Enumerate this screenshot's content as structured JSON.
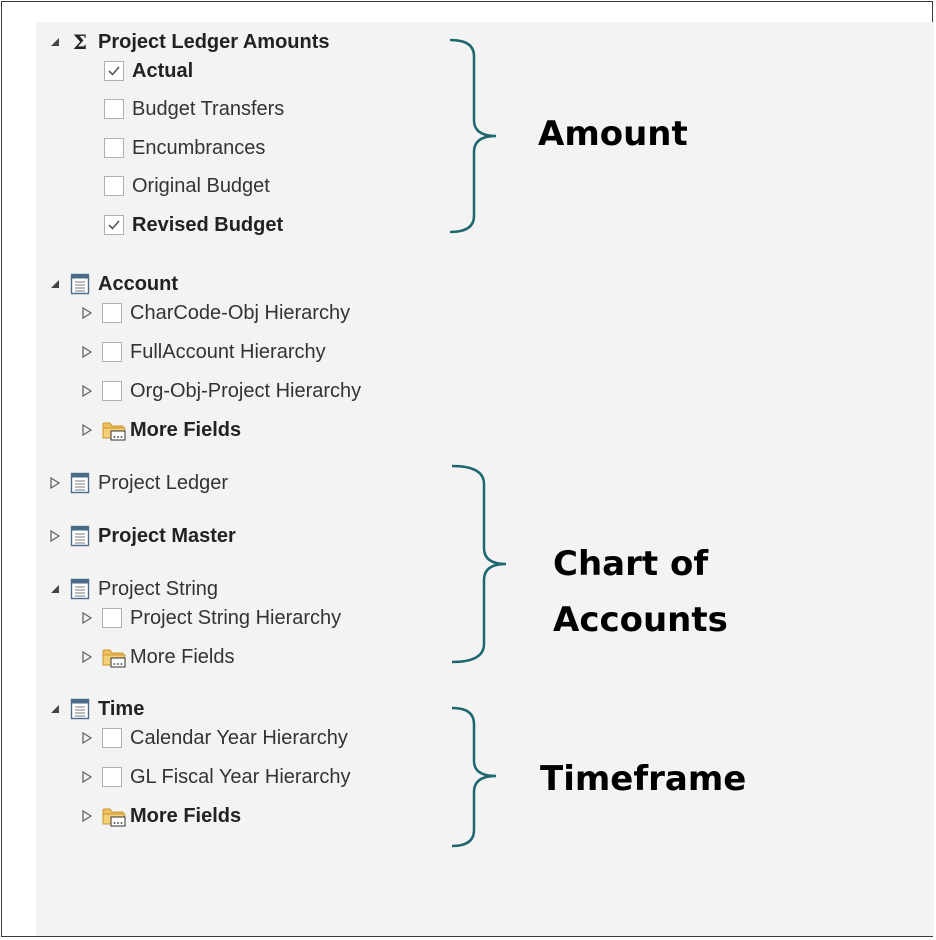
{
  "tree": {
    "ledger_amounts": {
      "label": "Project Ledger Amounts",
      "icon": "sigma-icon",
      "glyph": "Σ",
      "items": [
        {
          "label": "Actual",
          "checked": true
        },
        {
          "label": "Budget Transfers",
          "checked": false
        },
        {
          "label": "Encumbrances",
          "checked": false
        },
        {
          "label": "Original Budget",
          "checked": false
        },
        {
          "label": "Revised Budget",
          "checked": true
        }
      ]
    },
    "account": {
      "label": "Account",
      "icon": "table-icon",
      "items": [
        {
          "label": "CharCode-Obj Hierarchy",
          "checked": false
        },
        {
          "label": "FullAccount Hierarchy",
          "checked": false
        },
        {
          "label": "Org-Obj-Project Hierarchy",
          "checked": false
        }
      ],
      "more_fields": "More Fields"
    },
    "project_ledger": {
      "label": "Project Ledger",
      "icon": "table-icon"
    },
    "project_master": {
      "label": "Project Master",
      "icon": "table-icon"
    },
    "project_string": {
      "label": "Project String",
      "icon": "table-icon",
      "items": [
        {
          "label": "Project String Hierarchy",
          "checked": false
        }
      ],
      "more_fields": "More Fields"
    },
    "time": {
      "label": "Time",
      "icon": "table-icon",
      "items": [
        {
          "label": "Calendar Year Hierarchy",
          "checked": false
        },
        {
          "label": "GL Fiscal Year Hierarchy",
          "checked": false
        }
      ],
      "more_fields": "More Fields"
    }
  },
  "annotations": {
    "amount": "Amount",
    "chart_of_accounts_line1": "Chart of",
    "chart_of_accounts_line2": "Accounts",
    "timeframe": "Timeframe"
  },
  "colors": {
    "brace": "#1e6670",
    "panel_bg": "#f3f3f3",
    "folder": "#f0c060"
  }
}
